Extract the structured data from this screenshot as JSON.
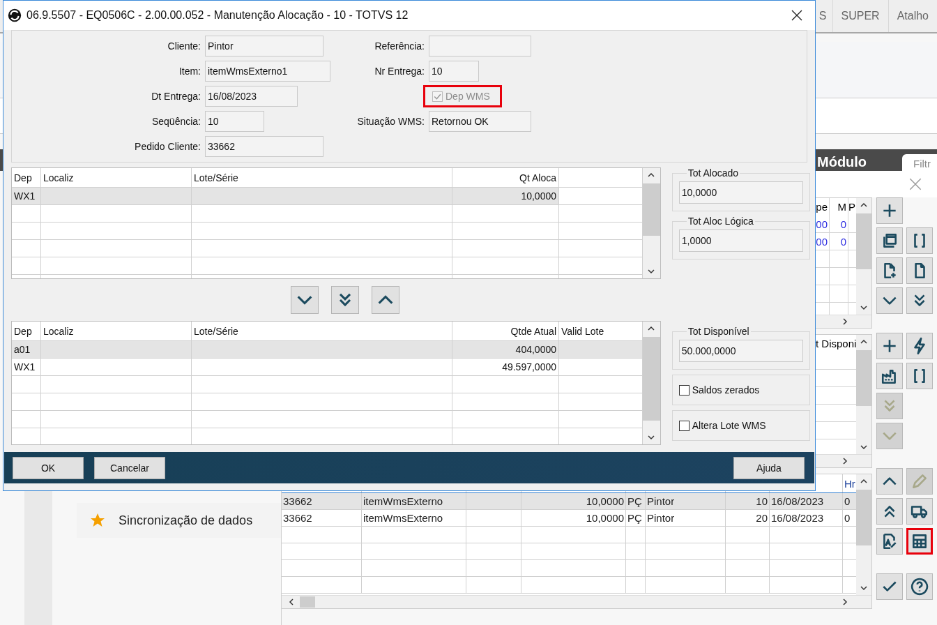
{
  "header_tabs": [
    {
      "label": "S"
    },
    {
      "label": "SUPER"
    },
    {
      "label": "Atalho"
    }
  ],
  "module_bar": {
    "title": "Módulo",
    "filter_tab": "Filtr"
  },
  "favorites": [
    {
      "label": "Sincronização de dados",
      "starred": true
    }
  ],
  "browser_window": {
    "grid_top": {
      "columns": [
        "pe",
        "M",
        "P"
      ],
      "rows": [
        {
          "column_1": "00",
          "column_2": "0"
        },
        {
          "column_1": "00",
          "column_2": "0"
        }
      ]
    },
    "grid_middle": {
      "columns": [
        "t Disponi"
      ]
    },
    "grid_bottom": {
      "columns": [
        "Hr"
      ],
      "rows": [
        {
          "column_1": "33662",
          "column_2": "itemWmsExterno",
          "column_4": "10,0000",
          "column_5": "PÇ",
          "column_6": "Pintor",
          "column_7": "10",
          "column_8": "16/08/2023",
          "column_9": "0",
          "selected": true
        },
        {
          "column_1": "33662",
          "column_2": "itemWmsExterno",
          "column_4": "10,0000",
          "column_5": "PÇ",
          "column_6": "Pintor",
          "column_7": "20",
          "column_8": "16/08/2023",
          "column_9": "0",
          "selected": false
        }
      ]
    },
    "toolbar": [
      [
        [
          {
            "kind": "plus",
            "disabled": false,
            "highlighted": false
          }
        ],
        [
          {
            "kind": "copy",
            "disabled": false,
            "highlighted": false
          },
          {
            "kind": "brackets",
            "disabled": false,
            "highlighted": false
          }
        ],
        [
          {
            "kind": "file-add",
            "disabled": false,
            "highlighted": false
          },
          {
            "kind": "file",
            "disabled": false,
            "highlighted": false
          }
        ],
        [
          {
            "kind": "down",
            "disabled": false,
            "highlighted": false
          },
          {
            "kind": "double-down",
            "disabled": false,
            "highlighted": false
          }
        ]
      ],
      [
        [
          {
            "kind": "plus",
            "disabled": false,
            "highlighted": false
          },
          {
            "kind": "lightning",
            "disabled": false,
            "highlighted": false
          }
        ],
        [
          {
            "kind": "factory",
            "disabled": false,
            "highlighted": false
          },
          {
            "kind": "brackets",
            "disabled": false,
            "highlighted": false
          }
        ],
        [
          {
            "kind": "double-down",
            "disabled": true,
            "highlighted": false
          }
        ],
        [
          {
            "kind": "down",
            "disabled": true,
            "highlighted": false
          }
        ]
      ],
      [
        [
          {
            "kind": "up",
            "disabled": false,
            "highlighted": false
          },
          {
            "kind": "pencil",
            "disabled": true,
            "highlighted": false
          }
        ],
        [
          {
            "kind": "double-up",
            "disabled": false,
            "highlighted": false
          },
          {
            "kind": "truck",
            "disabled": false,
            "highlighted": false
          }
        ],
        [
          {
            "kind": "doc-edit",
            "disabled": false,
            "highlighted": false
          },
          {
            "kind": "calculator",
            "disabled": false,
            "highlighted": true
          }
        ]
      ],
      [
        [
          {
            "kind": "check",
            "disabled": false,
            "highlighted": false
          },
          {
            "kind": "help",
            "disabled": false,
            "highlighted": false
          }
        ]
      ]
    ]
  },
  "dialog": {
    "title": "06.9.5507 - EQ0506C - 2.00.00.052 - Manutenção Alocação - 10 - TOTVS 12",
    "header_fields": {
      "left": [
        {
          "label": "Cliente:",
          "value": "Pintor"
        },
        {
          "label": "Item:",
          "value": "itemWmsExterno1"
        },
        {
          "label": "Dt Entrega:",
          "value": "16/08/2023"
        },
        {
          "label": "Seqüência:",
          "value": "10"
        },
        {
          "label": "Pedido Cliente:",
          "value": "33662"
        }
      ],
      "right": [
        {
          "kind": "field",
          "label": "Referência:"
        },
        {
          "kind": "field",
          "label": "Nr Entrega:",
          "value": "10"
        },
        {
          "kind": "checkbox",
          "label": "Dep WMS",
          "checked": true,
          "disabled": true,
          "highlighted": true
        },
        {
          "kind": "field",
          "label": "Situação WMS:",
          "value": "Retornou OK"
        }
      ]
    },
    "allocations": {
      "columns": [
        "Dep",
        "Localiz",
        "Lote/Série",
        "Qt Aloca"
      ],
      "rows": [
        {
          "dep": "WX1",
          "quantity": "10,0000",
          "selected": true
        }
      ]
    },
    "totals": [
      {
        "label": "Tot Alocado",
        "value": "10,0000"
      },
      {
        "label": "Tot Aloc Lógica",
        "value": "1,0000"
      }
    ],
    "move_buttons": [
      {
        "kind": "down"
      },
      {
        "kind": "double-down"
      },
      {
        "kind": "up"
      }
    ],
    "balances": {
      "columns": [
        "Dep",
        "Localiz",
        "Lote/Série",
        "Qtde Atual",
        "Valid Lote"
      ],
      "rows": [
        {
          "dep": "a01",
          "quantity": "404,0000",
          "selected": true
        },
        {
          "dep": "WX1",
          "quantity": "49.597,0000",
          "selected": false
        }
      ]
    },
    "available_total": {
      "label": "Tot Disponível",
      "value": "50.000,0000"
    },
    "options": [
      {
        "label": "Saldos zerados",
        "checked": false
      },
      {
        "label": "Altera Lote WMS",
        "checked": false
      }
    ],
    "buttons": [
      {
        "label": "OK"
      },
      {
        "label": "Cancelar"
      },
      {
        "label": "Ajuda"
      }
    ]
  }
}
